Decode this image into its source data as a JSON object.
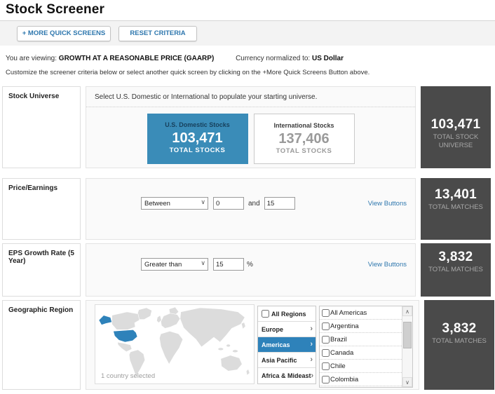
{
  "header": {
    "title": "Stock Screener"
  },
  "toolbar": {
    "more_screens_label": "+ MORE QUICK SCREENS",
    "reset_label": "RESET CRITERIA"
  },
  "viewing": {
    "prefix": "You are viewing:",
    "screen_name": "GROWTH AT A REASONABLE PRICE (GAARP)",
    "currency_prefix": "Currency normalized to:",
    "currency_value": "US Dollar",
    "instructions": "Customize the screener criteria below or select another quick screen by clicking on the +More Quick Screens Button above."
  },
  "universe": {
    "label": "Stock Universe",
    "instruction": "Select U.S. Domestic or International to populate your starting universe.",
    "domestic": {
      "title": "U.S. Domestic Stocks",
      "value": "103,471",
      "caption": "TOTAL STOCKS",
      "selected": true
    },
    "international": {
      "title": "International Stocks",
      "value": "137,406",
      "caption": "TOTAL STOCKS",
      "selected": false
    },
    "total": {
      "value": "103,471",
      "caption": "TOTAL STOCK UNIVERSE"
    }
  },
  "pe": {
    "label": "Price/Earnings",
    "operator": "Between",
    "min_value": "0",
    "and_label": "and",
    "max_value": "15",
    "view_buttons_label": "View Buttons",
    "total": {
      "value": "13,401",
      "caption": "TOTAL MATCHES"
    }
  },
  "eps": {
    "label": "EPS Growth Rate (5 Year)",
    "operator": "Greater than",
    "value": "15",
    "unit": "%",
    "view_buttons_label": "View Buttons",
    "total": {
      "value": "3,832",
      "caption": "TOTAL MATCHES"
    }
  },
  "geo": {
    "label": "Geographic Region",
    "map_caption": "1 country selected",
    "all_regions_label": "All Regions",
    "regions": [
      {
        "label": "Europe",
        "selected": false
      },
      {
        "label": "Americas",
        "selected": true
      },
      {
        "label": "Asia Pacific",
        "selected": false
      },
      {
        "label": "Africa & Mideast",
        "selected": false
      }
    ],
    "countries": [
      "All Americas",
      "Argentina",
      "Brazil",
      "Canada",
      "Chile",
      "Colombia"
    ],
    "countries_checked": [],
    "total": {
      "value": "3,832",
      "caption": "TOTAL MATCHES"
    }
  },
  "icons": {
    "chevron_down": "∨",
    "chevron_right": "›",
    "scroll_up": "∧",
    "scroll_down": "∨"
  },
  "colors": {
    "accent_blue": "#3a8cb8",
    "selection_blue": "#2e82ba",
    "dark_panel": "#4a4a4a",
    "link_blue": "#2e77ae"
  }
}
